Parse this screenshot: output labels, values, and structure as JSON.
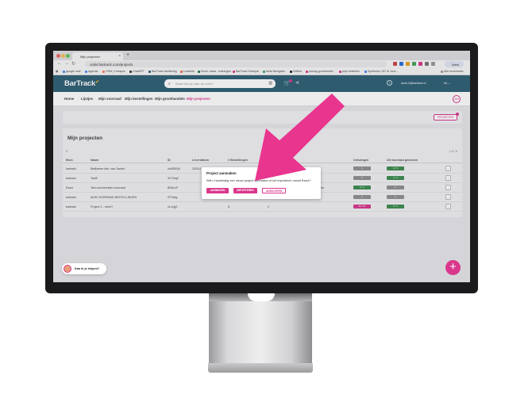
{
  "browser": {
    "tab_title": "Mijn projecten",
    "tab_close": "×",
    "new_tab": "+",
    "url": "order.bartrack.com/projects",
    "profile": "Werk",
    "bookmarks": [
      "google mail",
      "Agenda",
      "CRM | Hubspot",
      "ChatGPT",
      "BarTrack facilitering",
      "Leadinfo",
      "Excel: basis - trainingen",
      "BarTrack Hubspot",
      "tekla Navigator",
      "GitHub",
      "pricing groothandel",
      "prijs bestellen",
      "Synthesis | BT AI Voor..."
    ],
    "all_bookmarks": "Alle bookmarks"
  },
  "app": {
    "logo": "BarTrack",
    "search_placeholder": "Waar ben je naar op zoek?",
    "user_email": "anne.h@bartrack.nl",
    "lang": "NL",
    "user_initials": "AH"
  },
  "nav": [
    "Home",
    "Lijstjes",
    "Mijn voorraad",
    "Mijn bestellingen",
    "Mijn groothandels",
    "Mijn projecten"
  ],
  "toolbar": {
    "new_project": "PROJECTEN"
  },
  "projects": {
    "title": "Mijn projecten",
    "filter": "0",
    "pager": "1-5 / 5",
    "columns": [
      "Bron",
      "Naam",
      "ID",
      "Leverdatum",
      "# Bestellingen",
      "",
      "",
      "Ontvangen",
      "Uit voorraad genomen"
    ],
    "rows": [
      {
        "bron": "bartrack",
        "naam": "Badkamer fam. van Zanten",
        "id": "zk4fD5Qk",
        "datum": "2025-0",
        "best": "",
        "col6": "",
        "col7": "",
        "ontv": "0",
        "uit": "3 / 3",
        "ontv_color": "#8f8f93",
        "uit_color": "#3d8c4f"
      },
      {
        "bron": "bartrack",
        "naam": "Test5",
        "id": "3CYNqZ",
        "datum": "",
        "best": "",
        "col6": "",
        "col7": "",
        "ontv": "0",
        "uit": "4 / 4",
        "ontv_color": "#8f8f93",
        "uit_color": "#3d8c4f"
      },
      {
        "bron": "Exact",
        "naam": "Test voorbereiden voorraad",
        "id": "8D8LoP",
        "datum": "",
        "best": "",
        "col6": "",
        "col7": "Planden",
        "ontv": "2 / 2",
        "uit": "0",
        "ontv_color": "#3d8c4f",
        "uit_color": "#8f8f93"
      },
      {
        "bron": "bartrack",
        "naam": "MIJN VOORRAAD BESTELLINGEN",
        "id": "9TYkdg",
        "datum": "",
        "best": "0",
        "col6": "",
        "col7": "",
        "ontv": "0",
        "uit": "0",
        "ontv_color": "#8f8f93",
        "uit_color": "#8f8f93"
      },
      {
        "bron": "bartrack",
        "naam": "Project X - rekerT",
        "id": "rA-CgjS",
        "datum": "",
        "best": "8",
        "col6": "2",
        "col7": "",
        "ontv": "49 / 61",
        "uit": "3 / 7",
        "ontv_color": "#d9378c",
        "uit_color": "#3d8c4f"
      }
    ]
  },
  "modal": {
    "title": "Project aanmaken",
    "text": "Wilt u handmatig een nieuw project aanmaken of het importeren vanuit Exact?",
    "btn_manual": "AANMAKEN",
    "btn_import": "IMPORTEREN",
    "btn_cancel": "ANNULEREN"
  },
  "chat": {
    "label": "Kan ik je helpen?"
  },
  "fab": {
    "label": "+"
  },
  "colors": {
    "brand": "#2e5f74",
    "accent": "#d9378c",
    "arrow": "#e8368f"
  }
}
